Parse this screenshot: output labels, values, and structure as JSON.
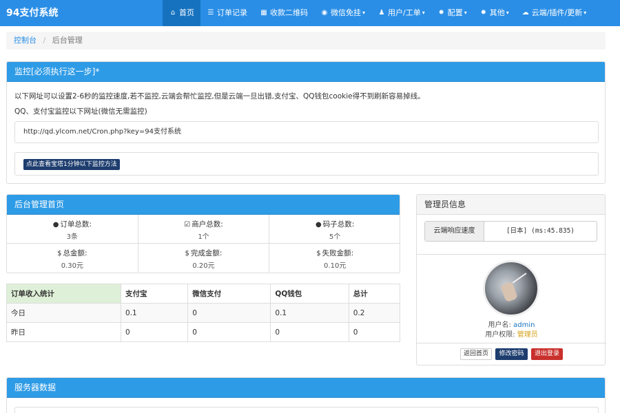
{
  "navbar": {
    "brand": "94支付系统",
    "items": [
      {
        "label": "首页",
        "icon": "home-icon",
        "glyph": "⌂",
        "active": true,
        "caret": ""
      },
      {
        "label": "订单记录",
        "icon": "list-icon",
        "glyph": "☰",
        "active": false,
        "caret": ""
      },
      {
        "label": "收款二维码",
        "icon": "qrcode-icon",
        "glyph": "▦",
        "active": false,
        "caret": ""
      },
      {
        "label": "微信免挂",
        "icon": "wechat-icon",
        "glyph": "◉",
        "active": false,
        "caret": "▾"
      },
      {
        "label": "用户/工单",
        "icon": "user-icon",
        "glyph": "♟",
        "active": false,
        "caret": "▾"
      },
      {
        "label": "配置",
        "icon": "gear-icon",
        "glyph": "✹",
        "active": false,
        "caret": "▾"
      },
      {
        "label": "其他",
        "icon": "cogs-icon",
        "glyph": "✹",
        "active": false,
        "caret": "▾"
      },
      {
        "label": "云端/插件/更新",
        "icon": "cloud-icon",
        "glyph": "☁",
        "active": false,
        "caret": "▾"
      }
    ]
  },
  "breadcrumb": {
    "home": "控制台",
    "separator": "/",
    "current": "后台管理"
  },
  "monitor": {
    "title": "监控[必须执行这一步]*",
    "line1": "以下网址可以设置2-6秒的监控速度,若不监控,云端会帮忙监控,但是云端一旦出错,支付宝、QQ钱包cookie得不到刷新容易掉线。",
    "line2": "QQ、支付宝监控以下网址(微信无需监控)",
    "url": "http://qd.ylcom.net/Cron.php?key=94支付系统",
    "button": "点此查看宝塔1分钟以下监控方法"
  },
  "dashboard": {
    "title": "后台管理首页",
    "stats": [
      {
        "label": "订单总数:",
        "value": "3条",
        "icon": "tint-icon",
        "glyph": "●"
      },
      {
        "label": "商户总数:",
        "value": "1个",
        "icon": "check-square-icon",
        "glyph": "☑"
      },
      {
        "label": "码子总数:",
        "value": "5个",
        "icon": "info-circle-icon",
        "glyph": "●"
      },
      {
        "label": "总金额:",
        "value": "0.30元",
        "icon": "dollar-icon",
        "glyph": "$"
      },
      {
        "label": "完成金额:",
        "value": "0.20元",
        "icon": "dollar-icon",
        "glyph": "$"
      },
      {
        "label": "失败金额:",
        "value": "0.10元",
        "icon": "dollar-icon",
        "glyph": "$"
      }
    ]
  },
  "income": {
    "headers": [
      "订单收入统计",
      "支付宝",
      "微信支付",
      "QQ钱包",
      "总计"
    ],
    "rows": [
      [
        "今日",
        "0.1",
        "0",
        "0.1",
        "0.2"
      ],
      [
        "昨日",
        "0",
        "0",
        "0",
        "0"
      ]
    ]
  },
  "admin": {
    "title": "管理员信息",
    "speed_label": "云端响应速度",
    "speed_value": "[日本] (ms:45.835)",
    "username_label": "用户名:",
    "username": "admin",
    "role_label": "用户权限:",
    "role": "管理员",
    "buttons": {
      "home": "返回首页",
      "password": "修改密码",
      "logout": "退出登录"
    }
  },
  "server": {
    "title": "服务器数据"
  },
  "colors": {
    "primary": "#2a8ee6",
    "active_nav": "#1672bf",
    "dark_button": "#1d3d6e",
    "danger": "#c9302c",
    "role": "#d4a017",
    "success_bg": "#dff0d8"
  }
}
